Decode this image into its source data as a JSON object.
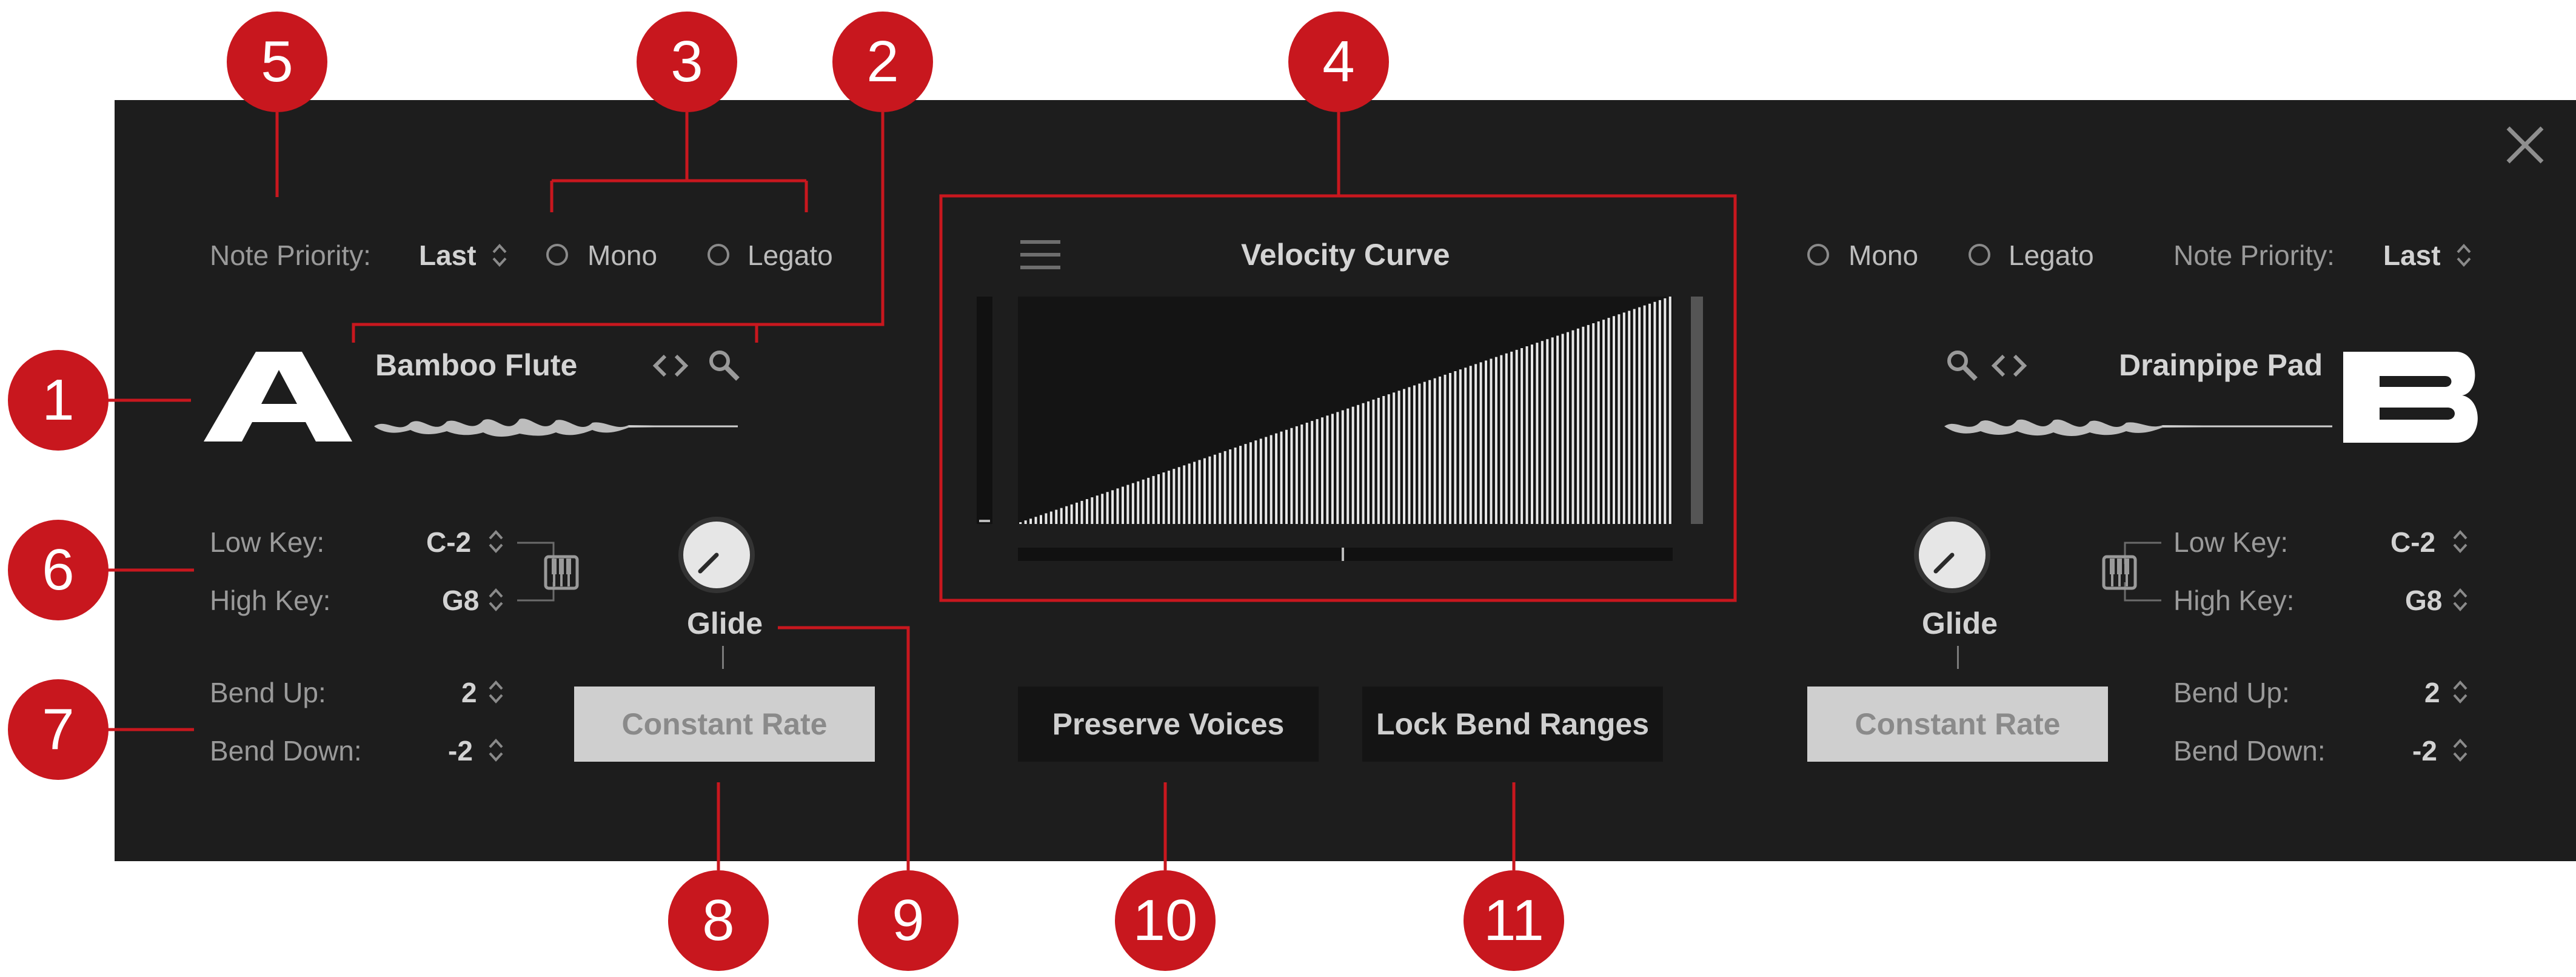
{
  "left": {
    "note_priority_label": "Note Priority:",
    "note_priority_value": "Last",
    "mono_label": "Mono",
    "legato_label": "Legato",
    "slot_letter": "A",
    "instrument_name": "Bamboo Flute",
    "low_key_label": "Low Key:",
    "low_key_value": "C-2",
    "high_key_label": "High Key:",
    "high_key_value": "G8",
    "bend_up_label": "Bend Up:",
    "bend_up_value": "2",
    "bend_down_label": "Bend Down:",
    "bend_down_value": "-2",
    "glide_label": "Glide",
    "constant_rate_label": "Constant Rate"
  },
  "right": {
    "note_priority_label": "Note Priority:",
    "note_priority_value": "Last",
    "mono_label": "Mono",
    "legato_label": "Legato",
    "slot_letter": "B",
    "instrument_name": "Drainpipe Pad",
    "low_key_label": "Low Key:",
    "low_key_value": "C-2",
    "high_key_label": "High Key:",
    "high_key_value": "G8",
    "bend_up_label": "Bend Up:",
    "bend_up_value": "2",
    "bend_down_label": "Bend Down:",
    "bend_down_value": "-2",
    "glide_label": "Glide",
    "constant_rate_label": "Constant Rate"
  },
  "center": {
    "velocity_curve_title": "Velocity Curve",
    "preserve_voices_label": "Preserve Voices",
    "lock_bend_ranges_label": "Lock Bend Ranges"
  },
  "callouts": [
    "1",
    "2",
    "3",
    "4",
    "5",
    "6",
    "7",
    "8",
    "9",
    "10",
    "11"
  ],
  "icons": {
    "close": "close-icon",
    "menu": "menu-icon",
    "search": "search-icon",
    "prev_next": "chevron-left-right-icon",
    "keyboard": "keyboard-icon",
    "stepper": "up-down-stepper-icon"
  },
  "colors": {
    "panel": "#1d1d1d",
    "callout": "#c8171e",
    "text_label": "#9a9a9a",
    "text_value": "#d2d2d2",
    "button_light": "#cfcfcf",
    "button_dark": "#141414"
  }
}
